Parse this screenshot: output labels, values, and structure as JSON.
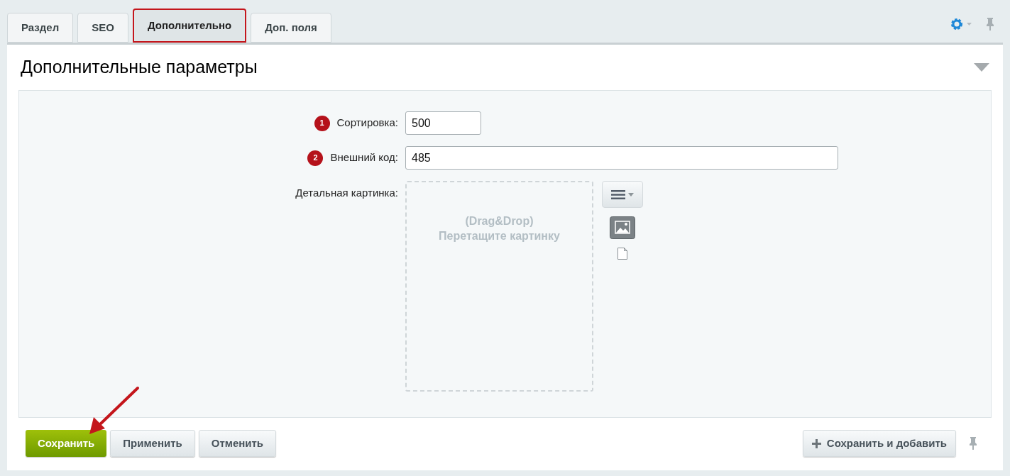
{
  "tabs": [
    {
      "label": "Раздел",
      "selected": false,
      "highlighted": false
    },
    {
      "label": "SEO",
      "selected": false,
      "highlighted": false
    },
    {
      "label": "Дополнительно",
      "selected": true,
      "highlighted": true
    },
    {
      "label": "Доп. поля",
      "selected": false,
      "highlighted": false
    }
  ],
  "section": {
    "title": "Дополнительные параметры",
    "expanded": true
  },
  "fields": [
    {
      "kind": "text",
      "marker": "1",
      "label": "Сортировка:",
      "value": "500",
      "wide": false
    },
    {
      "kind": "text",
      "marker": "2",
      "label": "Внешний код:",
      "value": "485",
      "wide": true
    },
    {
      "kind": "image",
      "label": "Детальная картинка:",
      "drop_hint": "(Drag&Drop)",
      "drop_text": "Перетащите картинку"
    }
  ],
  "buttons": [
    {
      "label": "Сохранить",
      "kind": "primary",
      "arrow": true
    },
    {
      "label": "Применить",
      "kind": "default",
      "arrow": false
    },
    {
      "label": "Отменить",
      "kind": "default",
      "arrow": false
    }
  ],
  "extra_button": {
    "label": "Сохранить и добавить"
  }
}
